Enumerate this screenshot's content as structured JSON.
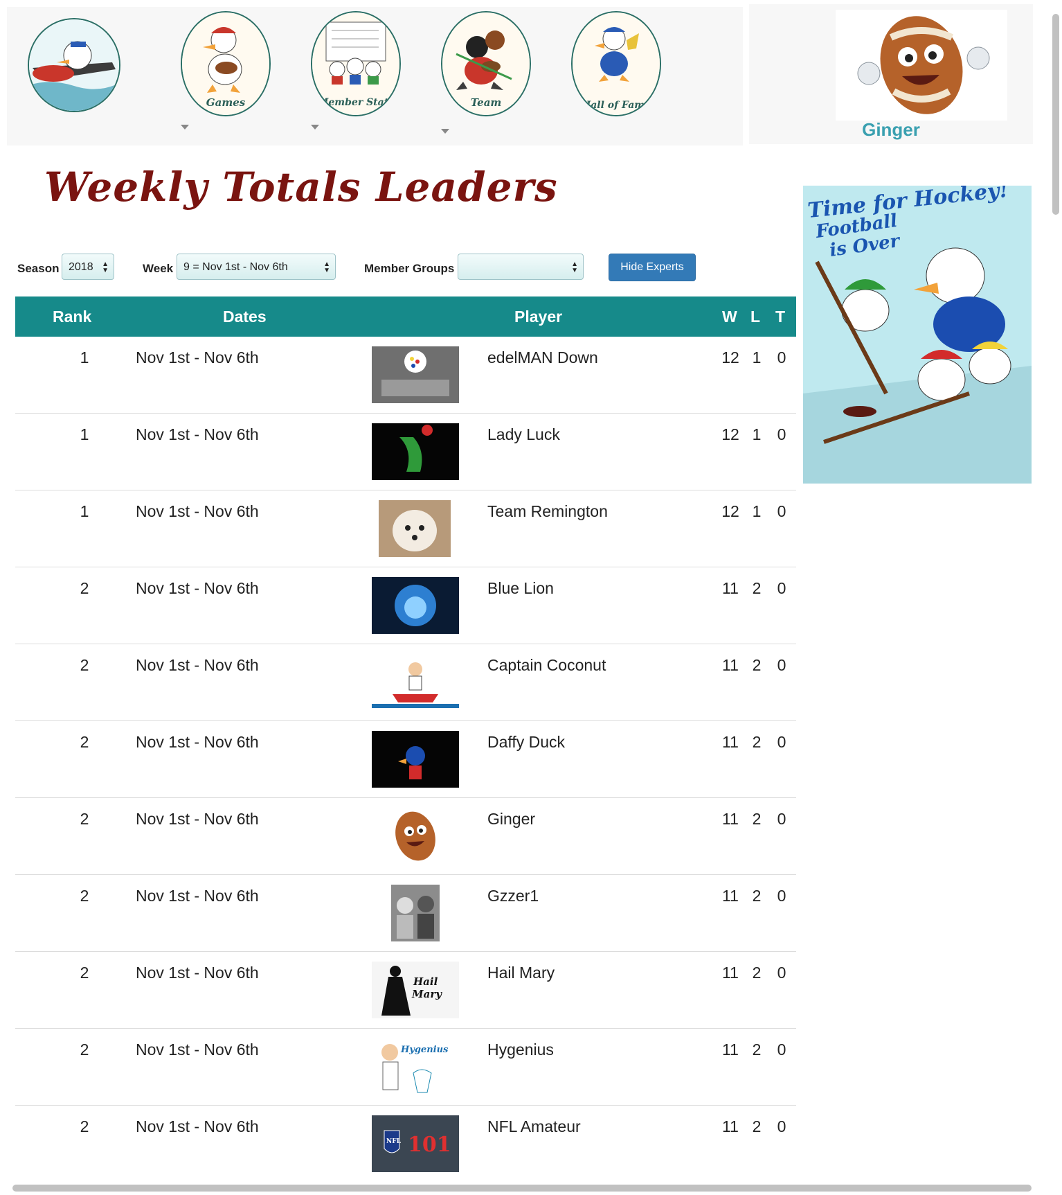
{
  "nav": {
    "items": [
      {
        "label": "",
        "icon": "home-plane-icon"
      },
      {
        "label": "Games",
        "icon": "games-icon"
      },
      {
        "label": "Member Stats",
        "icon": "member-stats-icon"
      },
      {
        "label": "Team",
        "icon": "team-icon"
      },
      {
        "label": "Hall of Fame",
        "icon": "hall-of-fame-icon"
      }
    ]
  },
  "user": {
    "name": "Ginger"
  },
  "page": {
    "title": "Weekly Totals Leaders"
  },
  "filters": {
    "season_label": "Season",
    "season_value": "2018",
    "week_label": "Week",
    "week_value": "9 = Nov 1st - Nov 6th",
    "groups_label": "Member Groups",
    "groups_value": "",
    "hide_experts_label": "Hide Experts"
  },
  "table": {
    "headers": {
      "rank": "Rank",
      "dates": "Dates",
      "player": "Player",
      "w": "W",
      "l": "L",
      "t": "T"
    },
    "rows": [
      {
        "rank": "1",
        "dates": "Nov 1st - Nov 6th",
        "player": "edelMAN Down",
        "w": "12",
        "l": "1",
        "t": "0",
        "avatar": "steelers-trophies"
      },
      {
        "rank": "1",
        "dates": "Nov 1st - Nov 6th",
        "player": "Lady Luck",
        "w": "12",
        "l": "1",
        "t": "0",
        "avatar": "lady-luck"
      },
      {
        "rank": "1",
        "dates": "Nov 1st - Nov 6th",
        "player": "Team Remington",
        "w": "12",
        "l": "1",
        "t": "0",
        "avatar": "dog"
      },
      {
        "rank": "2",
        "dates": "Nov 1st - Nov 6th",
        "player": "Blue Lion",
        "w": "11",
        "l": "2",
        "t": "0",
        "avatar": "blue-lion"
      },
      {
        "rank": "2",
        "dates": "Nov 1st - Nov 6th",
        "player": "Captain Coconut",
        "w": "11",
        "l": "2",
        "t": "0",
        "avatar": "captain-boat"
      },
      {
        "rank": "2",
        "dates": "Nov 1st - Nov 6th",
        "player": "Daffy Duck",
        "w": "11",
        "l": "2",
        "t": "0",
        "avatar": "duck-hero"
      },
      {
        "rank": "2",
        "dates": "Nov 1st - Nov 6th",
        "player": "Ginger",
        "w": "11",
        "l": "2",
        "t": "0",
        "avatar": "football-face"
      },
      {
        "rank": "2",
        "dates": "Nov 1st - Nov 6th",
        "player": "Gzzer1",
        "w": "11",
        "l": "2",
        "t": "0",
        "avatar": "two-dogs"
      },
      {
        "rank": "2",
        "dates": "Nov 1st - Nov 6th",
        "player": "Hail Mary",
        "w": "11",
        "l": "2",
        "t": "0",
        "avatar": "hail-mary",
        "avatar_text": [
          "Hail",
          "Mary"
        ]
      },
      {
        "rank": "2",
        "dates": "Nov 1st - Nov 6th",
        "player": "Hygenius",
        "w": "11",
        "l": "2",
        "t": "0",
        "avatar": "hygenius",
        "avatar_text": [
          "Hygenius"
        ]
      },
      {
        "rank": "2",
        "dates": "Nov 1st - Nov 6th",
        "player": "NFL Amateur",
        "w": "11",
        "l": "2",
        "t": "0",
        "avatar": "nfl-101",
        "avatar_text": [
          "NFL",
          "101"
        ]
      }
    ]
  },
  "ad": {
    "lines": [
      "Time for Hockey!",
      "Football",
      "is Over"
    ]
  },
  "colors": {
    "header_bg": "#168a8a",
    "title": "#7a1410",
    "user_name": "#3aa0b0",
    "button": "#337ab7"
  }
}
